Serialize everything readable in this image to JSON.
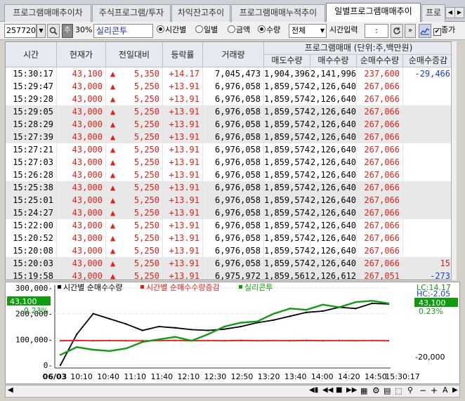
{
  "tabs": [
    {
      "label": "프로그램매매추이차"
    },
    {
      "label": "주식프로그램/투자"
    },
    {
      "label": "차익잔고추이"
    },
    {
      "label": "프로그램매매누적추이"
    },
    {
      "label": "일별프로그램매매추이"
    },
    {
      "label": "프로"
    }
  ],
  "toolbar": {
    "code": "257720",
    "ratio": "30%",
    "stock_name": "실리콘투",
    "radio_time": "시간별",
    "radio_daily": "일별",
    "radio_amount": "금액",
    "radio_qty": "수량",
    "scope": "전체",
    "time_input_label": "시간입력",
    "time_value": ":",
    "chk_label": "종가"
  },
  "table": {
    "headers": {
      "time": "시간",
      "price": "현재가",
      "change": "전일대비",
      "rate": "등락률",
      "volume": "거래량",
      "program": "프로그램매매 (단위:주,백만원)",
      "sell": "매도수량",
      "buy": "매수수량",
      "net": "순매수수량",
      "net_inc": "순매수증감"
    },
    "rows": [
      {
        "time": "15:30:17",
        "price": "43,100",
        "change": "5,350",
        "rate": "+14.17",
        "volume": "7,045,473",
        "sell": "1,904,396",
        "buy": "2,141,996",
        "net": "237,600",
        "inc": "-29,466",
        "alt": false
      },
      {
        "time": "15:29:47",
        "price": "43,000",
        "change": "5,250",
        "rate": "+13.91",
        "volume": "6,976,058",
        "sell": "1,859,574",
        "buy": "2,126,640",
        "net": "267,066",
        "inc": "",
        "alt": false
      },
      {
        "time": "15:29:28",
        "price": "43,000",
        "change": "5,250",
        "rate": "+13.91",
        "volume": "6,976,058",
        "sell": "1,859,574",
        "buy": "2,126,640",
        "net": "267,066",
        "inc": "",
        "alt": false
      },
      {
        "time": "15:29:05",
        "price": "43,000",
        "change": "5,250",
        "rate": "+13.91",
        "volume": "6,976,058",
        "sell": "1,859,574",
        "buy": "2,126,640",
        "net": "267,066",
        "inc": "",
        "alt": true
      },
      {
        "time": "15:28:29",
        "price": "43,000",
        "change": "5,250",
        "rate": "+13.91",
        "volume": "6,976,058",
        "sell": "1,859,574",
        "buy": "2,126,640",
        "net": "267,066",
        "inc": "",
        "alt": true
      },
      {
        "time": "15:27:39",
        "price": "43,000",
        "change": "5,250",
        "rate": "+13.91",
        "volume": "6,976,058",
        "sell": "1,859,574",
        "buy": "2,126,640",
        "net": "267,066",
        "inc": "",
        "alt": true
      },
      {
        "time": "15:27:21",
        "price": "43,000",
        "change": "5,250",
        "rate": "+13.91",
        "volume": "6,976,058",
        "sell": "1,859,574",
        "buy": "2,126,640",
        "net": "267,066",
        "inc": "",
        "alt": false
      },
      {
        "time": "15:27:03",
        "price": "43,000",
        "change": "5,250",
        "rate": "+13.91",
        "volume": "6,976,058",
        "sell": "1,859,574",
        "buy": "2,126,640",
        "net": "267,066",
        "inc": "",
        "alt": false
      },
      {
        "time": "15:26:28",
        "price": "43,000",
        "change": "5,250",
        "rate": "+13.91",
        "volume": "6,976,058",
        "sell": "1,859,574",
        "buy": "2,126,640",
        "net": "267,066",
        "inc": "",
        "alt": false
      },
      {
        "time": "15:25:38",
        "price": "43,000",
        "change": "5,250",
        "rate": "+13.91",
        "volume": "6,976,058",
        "sell": "1,859,574",
        "buy": "2,126,640",
        "net": "267,066",
        "inc": "",
        "alt": true
      },
      {
        "time": "15:25:01",
        "price": "43,000",
        "change": "5,250",
        "rate": "+13.91",
        "volume": "6,976,058",
        "sell": "1,859,574",
        "buy": "2,126,640",
        "net": "267,066",
        "inc": "",
        "alt": true
      },
      {
        "time": "15:24:27",
        "price": "43,000",
        "change": "5,250",
        "rate": "+13.91",
        "volume": "6,976,058",
        "sell": "1,859,574",
        "buy": "2,126,640",
        "net": "267,066",
        "inc": "",
        "alt": true
      },
      {
        "time": "15:22:00",
        "price": "43,000",
        "change": "5,250",
        "rate": "+13.91",
        "volume": "6,976,058",
        "sell": "1,859,574",
        "buy": "2,126,640",
        "net": "267,066",
        "inc": "",
        "alt": false
      },
      {
        "time": "15:20:52",
        "price": "43,000",
        "change": "5,250",
        "rate": "+13.91",
        "volume": "6,976,058",
        "sell": "1,859,574",
        "buy": "2,126,640",
        "net": "267,066",
        "inc": "",
        "alt": false
      },
      {
        "time": "15:20:08",
        "price": "43,000",
        "change": "5,250",
        "rate": "+13.91",
        "volume": "6,976,058",
        "sell": "1,859,574",
        "buy": "2,126,640",
        "net": "267,066",
        "inc": "",
        "alt": false
      },
      {
        "time": "15:20:03",
        "price": "43,000",
        "change": "5,250",
        "rate": "+13.91",
        "volume": "6,976,058",
        "sell": "1,859,574",
        "buy": "2,126,640",
        "net": "267,066",
        "inc": "15",
        "alt": true
      },
      {
        "time": "15:19:58",
        "price": "43,000",
        "change": "5,250",
        "rate": "+13.91",
        "volume": "6,975,972",
        "sell": "1,859,561",
        "buy": "2,126,612",
        "net": "267,051",
        "inc": "-273",
        "alt": true
      }
    ]
  },
  "chart_data": {
    "type": "line",
    "legend": [
      "시간별 순매수수량",
      "시간별 순매수수량증감",
      "실리콘투"
    ],
    "y_left_ticks": [
      "300,000-",
      "200,000-",
      "100,000-",
      "0-"
    ],
    "y_right_ticks": [
      "-20,000"
    ],
    "x_ticks": [
      "06/03",
      "10:10",
      "10:40",
      "11:10",
      "11:40",
      "12:10",
      "12:30",
      "12:50",
      "13:20",
      "13:40",
      "14:00",
      "14:20",
      "14:50",
      "15:30:17"
    ],
    "price_badge_left": "43,100",
    "pct_badge_left": "0.23%",
    "price_badge_right": "43,100",
    "pct_badge_right": "0.23%",
    "lc": "LC:14.17",
    "hc": "HC:-2.05",
    "ylim": [
      0,
      300000
    ],
    "series": [
      {
        "name": "시간별 순매수수량",
        "color": "#000000",
        "values": [
          0,
          120000,
          200000,
          180000,
          160000,
          135000,
          150000,
          145000,
          138000,
          135000,
          140000,
          150000,
          165000,
          175000,
          190000,
          205000,
          210000,
          225000,
          220000,
          240000,
          237600
        ]
      },
      {
        "name": "시간별 순매수수량증감",
        "color": "#e0201a",
        "values": [
          95000,
          96000,
          95000,
          95500,
          95000,
          94500,
          95500,
          96000,
          95000,
          95500,
          95000,
          96000,
          95000,
          95500,
          95000,
          96000,
          95000,
          95500,
          95000,
          95500,
          95000
        ]
      },
      {
        "name": "실리콘투",
        "color": "#139a13",
        "values": [
          40000,
          70000,
          60000,
          55000,
          65000,
          90000,
          100000,
          110000,
          95000,
          120000,
          150000,
          165000,
          170000,
          200000,
          220000,
          215000,
          235000,
          225000,
          245000,
          250000,
          240000
        ]
      }
    ]
  },
  "colors": {
    "up": "#e0201a",
    "blue": "#1a3ec8",
    "green": "#139a13",
    "grid_alt": "#e8e8e8"
  },
  "icons": [
    "dropdown-icon",
    "search-icon",
    "stock-type-icon",
    "chart-icon",
    "refresh-icon",
    "next-icon",
    "checkbox-icon",
    "scroll-left-icon",
    "play-icon",
    "stop-icon",
    "settings-icon",
    "zoom-icon",
    "add-icon"
  ]
}
